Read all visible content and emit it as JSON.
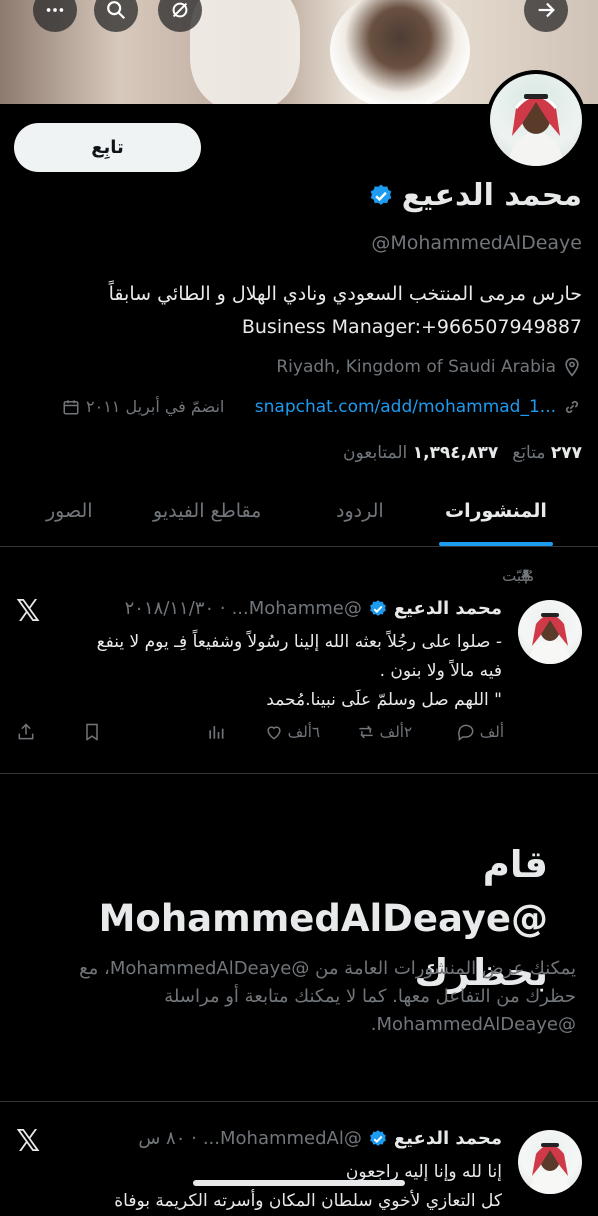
{
  "header": {
    "buttons": [
      "more-icon",
      "search-icon",
      "mute-icon",
      "back-arrow-icon"
    ]
  },
  "profile": {
    "follow_label": "تابِع",
    "name": "محمد الدعيع",
    "handle": "@MohammedAlDeaye",
    "bio_line1": "حارس مرمى المنتخب السعودي ونادي الهلال و الطائي سابقاً",
    "bio_line2": "Business Manager:+966507949887",
    "location": "Riyadh, Kingdom of Saudi Arabia",
    "link": "snapchat.com/add/mohammad_1...",
    "joined": "انضمّ في أبريل ٢٠١١",
    "following_count": "٢٧٧",
    "following_label": "متابَع",
    "followers_count": "١,٣٩٤,٨٣٧",
    "followers_label": "المتابعون",
    "verified_color": "#1d9bf0"
  },
  "tabs": [
    {
      "label": "المنشورات",
      "active": true
    },
    {
      "label": "الردود",
      "active": false
    },
    {
      "label": "مقاطع الفيديو",
      "active": false
    },
    {
      "label": "الصور",
      "active": false
    }
  ],
  "pinned_post": {
    "pinned_label": "مُثبّت",
    "author": "محمد الدعيع",
    "handle": "@Mohamme...",
    "date": "· ٢٠١٨/١١/٣٠",
    "text_line1": "- صلوا على رجُلاً بعثه الله إلينا رسُولاً وشفيعاً فِـ يوم لا ينفع",
    "text_line2": "فيه مالاً ولا بنون .",
    "text_line3": "\" اللهم صل وسلمّ علَى نبينا.مُحمد",
    "replies": "ألف",
    "reposts": "٢ألف",
    "likes": "٦ألف",
    "views": ""
  },
  "blocked": {
    "title": "قام @MohammedAlDeaye بحظرك",
    "description": "يمكنك عرض المنشورات العامة من @MohammedAlDeaye، مع حظرك من التفاعل معها. كما لا يمكنك متابعة أو مراسلة @MohammedAlDeaye."
  },
  "second_post": {
    "author": "محمد الدعيع",
    "handle": "@MohammedAl...",
    "time": "· ٨٠ س",
    "text_line1": "إنا لله وإنا إليه راجعون",
    "text_line2": "كل التعازي لأخوي سلطان المكان وأسرته الكريمة بوفاة"
  }
}
